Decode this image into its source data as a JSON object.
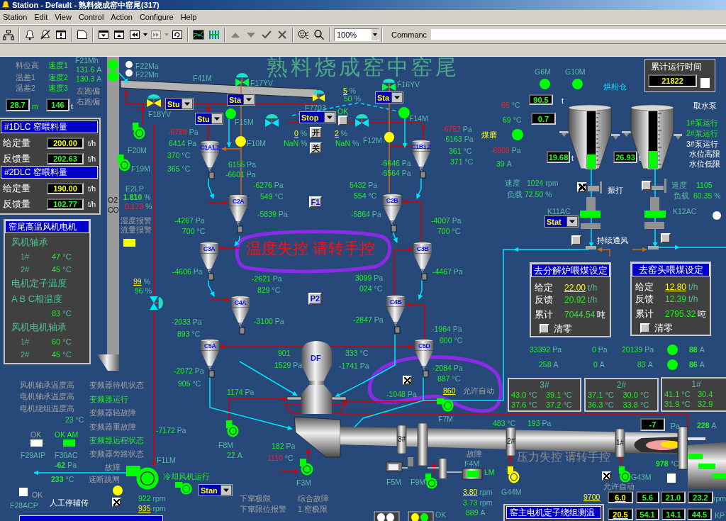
{
  "window": {
    "title": "Station - Default - 熟料烧成窑中窑尾(317)"
  },
  "menu": [
    "Station",
    "Edit",
    "View",
    "Control",
    "Action",
    "Configure",
    "Help"
  ],
  "toolbar": {
    "zoom": "100%",
    "command_label": "Commanc"
  },
  "diagram": {
    "title": "熟料烧成窑中窑尾",
    "banners": [
      {
        "text": "温度失控 请转手控",
        "kind": "alarm"
      },
      {
        "text": "压力失控 请转手控",
        "kind": "muted"
      }
    ],
    "labels": [
      {
        "text": "F21Mh",
        "kind": "tag"
      },
      {
        "text": "料位高",
        "kind": "muted"
      },
      {
        "text": "速度1",
        "kind": "value"
      },
      {
        "text": "131.6",
        "unit": "A",
        "kind": "value"
      },
      {
        "text": "F22Ma",
        "kind": "tag"
      },
      {
        "text": "G6M",
        "kind": "tag"
      },
      {
        "text": "G10M",
        "kind": "tag"
      },
      {
        "text": "温差1",
        "kind": "muted"
      },
      {
        "text": "速度2",
        "kind": "value"
      },
      {
        "text": "130.3",
        "unit": "A",
        "kind": "value"
      },
      {
        "text": "F22Mn",
        "kind": "tag"
      },
      {
        "text": "F41M",
        "kind": "tag"
      },
      {
        "text": "温差2",
        "kind": "muted"
      },
      {
        "text": "速度3",
        "kind": "value"
      },
      {
        "text": "左跑偏",
        "kind": "muted"
      },
      {
        "text": "F17YV",
        "kind": "tag"
      },
      {
        "text": "5",
        "unit": "%",
        "kind": "setpoint"
      },
      {
        "text": "F16YV",
        "kind": "tag"
      },
      {
        "text": "烘粉仓",
        "kind": "cyan"
      },
      {
        "text": "右跑偏",
        "kind": "muted"
      },
      {
        "text": "50",
        "unit": "%",
        "kind": "value"
      },
      {
        "text": "t",
        "kind": "note"
      },
      {
        "text": "m",
        "kind": "value"
      },
      {
        "text": "t",
        "kind": "note"
      },
      {
        "text": "F7703",
        "kind": "tag"
      },
      {
        "text": "66",
        "unit": "°C",
        "kind": "alarm"
      },
      {
        "text": "取水泵",
        "kind": "note"
      },
      {
        "text": "F18YV",
        "kind": "tag"
      },
      {
        "text": "OK",
        "kind": "value"
      },
      {
        "text": "F15M",
        "kind": "tag"
      },
      {
        "text": "F14M",
        "kind": "tag"
      },
      {
        "text": "69",
        "unit": "°C",
        "kind": "value"
      },
      {
        "text": "1#泵运行",
        "kind": "value"
      },
      {
        "text": "-6788",
        "unit": "Pa",
        "kind": "alarm"
      },
      {
        "text": "0",
        "unit": "%",
        "kind": "setpoint"
      },
      {
        "text": "2",
        "unit": "%",
        "kind": "setpoint"
      },
      {
        "text": "-6752",
        "unit": "Pa",
        "kind": "alarm"
      },
      {
        "text": "煤磨",
        "kind": "warning"
      },
      {
        "text": "2#泵运行",
        "kind": "value"
      },
      {
        "text": "6414",
        "unit": "Pa",
        "kind": "value"
      },
      {
        "text": "F10M",
        "kind": "tag"
      },
      {
        "text": "NaN",
        "unit": "%",
        "kind": "value"
      },
      {
        "text": "NaN",
        "unit": "%",
        "kind": "value"
      },
      {
        "text": "F12M",
        "kind": "tag"
      },
      {
        "text": "-6163",
        "unit": "Pa",
        "kind": "value"
      },
      {
        "text": "3#泵运行",
        "kind": "note"
      },
      {
        "text": "F20M",
        "kind": "tag"
      },
      {
        "text": "361",
        "unit": "°C",
        "kind": "value"
      },
      {
        "text": "-6903",
        "unit": "Pa",
        "kind": "alarm"
      },
      {
        "text": "370",
        "unit": "°C",
        "kind": "value"
      },
      {
        "text": "t",
        "kind": "note"
      },
      {
        "text": "t",
        "kind": "note"
      },
      {
        "text": "水位高限",
        "kind": "note"
      },
      {
        "text": "F19M",
        "kind": "tag"
      },
      {
        "text": "365",
        "unit": "°C",
        "kind": "value"
      },
      {
        "text": "6155",
        "unit": "Pa",
        "kind": "value"
      },
      {
        "text": "-6646",
        "unit": "Pa",
        "kind": "value"
      },
      {
        "text": "371",
        "unit": "°C",
        "kind": "value"
      },
      {
        "text": "39",
        "unit": "A",
        "kind": "value"
      },
      {
        "text": "水位低限",
        "kind": "note"
      },
      {
        "text": "-6601",
        "unit": "Pa",
        "kind": "value"
      },
      {
        "text": "-6564",
        "unit": "Pa",
        "kind": "value"
      },
      {
        "text": "E2LP",
        "kind": "tag"
      },
      {
        "text": "-6276",
        "unit": "Pa",
        "kind": "value"
      },
      {
        "text": "5432",
        "unit": "Pa",
        "kind": "value"
      },
      {
        "text": "速度",
        "kind": "tag"
      },
      {
        "text": "1024",
        "unit": "rpm",
        "kind": "value"
      },
      {
        "text": "振打",
        "kind": "note"
      },
      {
        "text": "速度",
        "kind": "tag"
      },
      {
        "text": "1105",
        "kind": "value"
      },
      {
        "text": "O2",
        "kind": "dark"
      },
      {
        "text": "1.810",
        "unit": "%",
        "kind": "strong"
      },
      {
        "text": "549",
        "unit": "°C",
        "kind": "value"
      },
      {
        "text": "554",
        "unit": "°C",
        "kind": "value"
      },
      {
        "text": "负载",
        "kind": "tag"
      },
      {
        "text": "72.50",
        "unit": "%",
        "kind": "value"
      },
      {
        "text": "负载",
        "kind": "tag"
      },
      {
        "text": "60.35",
        "unit": "%",
        "kind": "value"
      },
      {
        "text": "CO",
        "kind": "dark"
      },
      {
        "text": "0.173",
        "unit": "%",
        "kind": "alarm"
      },
      {
        "text": "-5839",
        "unit": "Pa",
        "kind": "value"
      },
      {
        "text": "-5864",
        "unit": "Pa",
        "kind": "value"
      },
      {
        "text": "K11AC",
        "kind": "tag"
      },
      {
        "text": "K12AC",
        "kind": "tag"
      },
      {
        "text": "湿度报警",
        "kind": "muted"
      },
      {
        "text": "-4267",
        "unit": "Pa",
        "kind": "value"
      },
      {
        "text": "-4007",
        "unit": "Pa",
        "kind": "value"
      },
      {
        "text": "流量报警",
        "kind": "muted"
      },
      {
        "text": "700",
        "unit": "°C",
        "kind": "value"
      },
      {
        "text": "700",
        "unit": "°C",
        "kind": "value"
      },
      {
        "text": "持续通风",
        "kind": "note"
      },
      {
        "text": "-4606",
        "unit": "Pa",
        "kind": "value"
      },
      {
        "text": "-4467",
        "unit": "Pa",
        "kind": "value"
      },
      {
        "text": "99",
        "unit": "%",
        "kind": "setpoint"
      },
      {
        "text": "-2621",
        "unit": "Pa",
        "kind": "value"
      },
      {
        "text": "3099",
        "unit": "Pa",
        "kind": "value"
      },
      {
        "text": "96",
        "unit": "%",
        "kind": "value"
      },
      {
        "text": "829",
        "unit": "°C",
        "kind": "value"
      },
      {
        "text": "024",
        "unit": "°C",
        "kind": "value"
      },
      {
        "text": "-2033",
        "unit": "Pa",
        "kind": "value"
      },
      {
        "text": "-3100",
        "unit": "Pa",
        "kind": "value"
      },
      {
        "text": "-2847",
        "unit": "Pa",
        "kind": "value"
      },
      {
        "text": "-1964",
        "unit": "Pa",
        "kind": "value"
      },
      {
        "text": "893",
        "unit": "°C",
        "kind": "value"
      },
      {
        "text": "000",
        "unit": "°C",
        "kind": "value"
      },
      {
        "text": "901",
        "kind": "value"
      },
      {
        "text": "333",
        "unit": "°C",
        "kind": "value"
      },
      {
        "text": "33392",
        "unit": "Pa",
        "kind": "value"
      },
      {
        "text": "0",
        "unit": "Pa",
        "kind": "value"
      },
      {
        "text": "20139",
        "unit": "Pa",
        "kind": "value"
      },
      {
        "text": "88",
        "unit": "A",
        "kind": "strong"
      },
      {
        "text": "1529",
        "unit": "Pa",
        "kind": "value"
      },
      {
        "text": "-1741",
        "unit": "Pa",
        "kind": "value"
      },
      {
        "text": "258",
        "unit": "A",
        "kind": "value"
      },
      {
        "text": "0",
        "unit": "A",
        "kind": "value"
      },
      {
        "text": "83",
        "unit": "A",
        "kind": "value"
      },
      {
        "text": "86",
        "unit": "A",
        "kind": "strong"
      },
      {
        "text": "-2072",
        "unit": "Pa",
        "kind": "value"
      },
      {
        "text": "-2084",
        "unit": "Pa",
        "kind": "value"
      },
      {
        "text": "887",
        "unit": "°C",
        "kind": "value"
      },
      {
        "text": "风机轴承温度高",
        "kind": "muted"
      },
      {
        "text": "变频器待机状态",
        "kind": "muted"
      },
      {
        "text": "905",
        "unit": "°C",
        "kind": "value"
      },
      {
        "text": "1174",
        "unit": "Pa",
        "kind": "value"
      },
      {
        "text": "860",
        "kind": "setpoint"
      },
      {
        "text": "允许自动",
        "kind": "muted"
      },
      {
        "text": "电机轴承温度高",
        "kind": "muted"
      },
      {
        "text": "-1048",
        "unit": "Pa",
        "kind": "value"
      },
      {
        "text": "变频器运行",
        "kind": "value"
      },
      {
        "text": "电机绕组温度高",
        "kind": "muted"
      },
      {
        "text": "变频器轻故障",
        "kind": "muted"
      },
      {
        "text": "23",
        "unit": "°C",
        "kind": "value"
      },
      {
        "text": "F7M",
        "kind": "tag"
      },
      {
        "text": "变频器重故障",
        "kind": "muted"
      },
      {
        "text": "483",
        "unit": "°C",
        "kind": "value"
      },
      {
        "text": "193",
        "unit": "Pa",
        "kind": "value"
      },
      {
        "text": "Pa",
        "kind": "tag"
      },
      {
        "text": "228",
        "unit": "A",
        "kind": "strong"
      },
      {
        "text": "OK",
        "kind": "muted"
      },
      {
        "text": "OK AM",
        "kind": "value"
      },
      {
        "text": "-7172",
        "unit": "Pa",
        "kind": "value"
      },
      {
        "text": "变频器远程状态",
        "kind": "value"
      },
      {
        "text": "F8M",
        "kind": "tag"
      },
      {
        "text": "182",
        "unit": "Pa",
        "kind": "value"
      },
      {
        "text": "F29AIP",
        "kind": "tag"
      },
      {
        "text": "F30AC",
        "kind": "tag"
      },
      {
        "text": "变频器旁路状态",
        "kind": "muted"
      },
      {
        "text": "F1LM",
        "kind": "tag"
      },
      {
        "text": "22",
        "unit": "A",
        "kind": "value"
      },
      {
        "text": "1110",
        "unit": "°C",
        "kind": "alarm"
      },
      {
        "text": "故障",
        "kind": "muted"
      },
      {
        "text": "-62",
        "unit": "Pa",
        "kind": "strong"
      },
      {
        "text": "故障",
        "kind": "muted"
      },
      {
        "text": "F4M",
        "kind": "tag"
      },
      {
        "text": "978",
        "unit": "°C",
        "kind": "strong"
      },
      {
        "text": "LM",
        "kind": "value"
      },
      {
        "text": "233",
        "unit": "°C",
        "kind": "strong"
      },
      {
        "text": "速断跳闸",
        "kind": "muted"
      },
      {
        "text": "冷却风机运行",
        "kind": "value"
      },
      {
        "text": "G43M",
        "kind": "tag"
      },
      {
        "text": "F3M",
        "kind": "tag"
      },
      {
        "text": "F5M",
        "kind": "tag"
      },
      {
        "text": "F9M",
        "kind": "tag"
      },
      {
        "text": "允许自动",
        "kind": "muted"
      },
      {
        "text": "OK",
        "kind": "muted"
      },
      {
        "text": "922",
        "unit": "rpm",
        "kind": "value"
      },
      {
        "text": "下窜极限",
        "kind": "muted"
      },
      {
        "text": "综合故障",
        "kind": "muted"
      },
      {
        "text": "3.80",
        "unit": "rpm",
        "kind": "setpoint"
      },
      {
        "text": "G44M",
        "kind": "tag"
      },
      {
        "text": "9700",
        "kind": "setpoint"
      },
      {
        "text": "rpm",
        "kind": "tag"
      },
      {
        "text": "F28ACP",
        "kind": "tag"
      },
      {
        "text": "人工停辅传",
        "kind": "note"
      },
      {
        "text": "3.73",
        "unit": "rpm",
        "kind": "value"
      },
      {
        "text": "935",
        "unit": "rpm",
        "kind": "setpoint"
      },
      {
        "text": "下窜限位报警",
        "kind": "muted"
      },
      {
        "text": "1.窑极限",
        "kind": "muted"
      },
      {
        "text": "OK",
        "kind": "tag"
      },
      {
        "text": "889",
        "unit": "A",
        "kind": "value"
      },
      {
        "text": "KP",
        "kind": "tag"
      }
    ],
    "readouts": [
      {
        "value": "28.7",
        "kind": "actual"
      },
      {
        "value": "146",
        "kind": "actual"
      },
      {
        "value": "90.5",
        "kind": "actual"
      },
      {
        "value": "0.7",
        "kind": "actual"
      },
      {
        "value": "19.68",
        "kind": "actual"
      },
      {
        "value": "26.93",
        "kind": "actual"
      },
      {
        "value": "-7",
        "kind": "actual"
      },
      {
        "value": "6.0",
        "kind": "set_link"
      },
      {
        "value": "5.6",
        "kind": "actual"
      },
      {
        "value": "21.0",
        "kind": "actual"
      },
      {
        "value": "23.2",
        "kind": "actual"
      },
      {
        "value": "20.5",
        "kind": "set_link"
      },
      {
        "value": "54.1",
        "kind": "actual"
      },
      {
        "value": "14.1",
        "kind": "actual"
      },
      {
        "value": "44.5",
        "kind": "actual"
      }
    ],
    "dropdowns": [
      {
        "value": "Stu"
      },
      {
        "value": "Sta"
      },
      {
        "value": "Sta"
      },
      {
        "value": "Stu"
      },
      {
        "value": "Stop"
      },
      {
        "value": "Stat"
      },
      {
        "value": "Stan"
      }
    ],
    "buttons": [
      {
        "label": "开",
        "kind": "command"
      },
      {
        "label": "关",
        "kind": "command"
      },
      {
        "label": "F1",
        "kind": "page"
      },
      {
        "label": "P2",
        "kind": "page"
      }
    ],
    "checkboxes": [
      {
        "checked": true
      },
      {
        "checked": false
      },
      {
        "checked": false
      },
      {
        "checked": false
      },
      {
        "checked": true
      },
      {
        "checked": true
      },
      {
        "checked": true
      }
    ],
    "lamps": [
      {
        "color": "#00ff00",
        "kind": "dot"
      },
      {
        "color": "#ffffff",
        "kind": "dot"
      },
      {
        "color": "#00ff00",
        "kind": "dot"
      },
      {
        "color": "#ffffff",
        "kind": "dot"
      },
      {
        "color": "#00ff00",
        "kind": "dot"
      },
      {
        "color": "#00ff00",
        "kind": "dot"
      },
      {
        "color": "#ffffff",
        "kind": "block"
      },
      {
        "color": "#00ff00",
        "kind": "dot"
      },
      {
        "color": "#00ff00",
        "kind": "dot"
      },
      {
        "color": "#ffff00",
        "kind": "dot"
      },
      {
        "color": "#ffff00",
        "kind": "dot"
      },
      {
        "color": "#00ff00",
        "kind": "dot"
      },
      {
        "color": "#ffffff",
        "kind": "dot"
      },
      {
        "color": "#ffff00",
        "kind": "block"
      },
      {
        "color": "#00ff00",
        "kind": "dot"
      },
      {
        "color": "#00ff00",
        "kind": "dot"
      },
      {
        "color": "#ffffff",
        "kind": "block"
      },
      {
        "color": "#00ff00",
        "kind": "block"
      },
      {
        "color": "#ffffff",
        "kind": "block"
      },
      {
        "color": "#ffffff",
        "kind": "block"
      },
      {
        "color": "#ffff00",
        "kind": "dot"
      },
      {
        "color": "#ffffff",
        "kind": "dot"
      },
      {
        "color": "#ffffff",
        "kind": "dot"
      },
      {
        "color": "#ffff00",
        "kind": "dot"
      },
      {
        "color": "#00ff00",
        "kind": "dot"
      }
    ],
    "fans": [
      {
        "color": "#00ff00"
      },
      {
        "color": "#00ff00"
      },
      {
        "color": "#00ff00"
      },
      {
        "color": "#00ff00"
      },
      {
        "color": "#00ff00"
      },
      {
        "color": "#00ff00"
      },
      {
        "color": "#00ff00"
      },
      {
        "color": "#00ff00"
      },
      {
        "color": "#ffff00"
      },
      {
        "color": "#00ff00"
      }
    ],
    "valves": [
      {
        "color": "#ffff00"
      },
      {
        "color": "#00ff40"
      },
      {
        "color": "#ffff00"
      },
      {
        "color": "#00ff40"
      },
      {
        "color": "#00e8ff"
      },
      {
        "color": "#00e8ff"
      },
      {
        "color": "#00e8ff"
      }
    ],
    "cyclones": [
      {
        "name": "C1A1,2"
      },
      {
        "name": "C1B1,2"
      },
      {
        "name": "C2A"
      },
      {
        "name": "C2B"
      },
      {
        "name": "C3A"
      },
      {
        "name": "C3B"
      },
      {
        "name": "C4A"
      },
      {
        "name": "C4B"
      },
      {
        "name": "C5A"
      },
      {
        "name": "C5D"
      }
    ],
    "calciner": {
      "name": "DF"
    },
    "kiln_rings": [
      "3#",
      "2#",
      "1#"
    ],
    "silos": [
      {
        "level": 0.24
      },
      {
        "level": 0.3
      }
    ],
    "feed_panel": {
      "sections": [
        {
          "title": "#1DLC 窑喂料量",
          "rows": [
            {
              "label": "给定量",
              "value": "200.00",
              "unit": "t/h",
              "kind": "set"
            },
            {
              "label": "反馈量",
              "value": "202.63",
              "unit": "t/h",
              "kind": "actual"
            }
          ]
        },
        {
          "title": "#2DLC 窑喂料量",
          "rows": [
            {
              "label": "给定量",
              "value": "190.00",
              "unit": "t/h",
              "kind": "set"
            },
            {
              "label": "反馈量",
              "value": "102.77",
              "unit": "t/h",
              "kind": "actual"
            }
          ]
        }
      ]
    },
    "motor_panel": {
      "title": "窑尾高温风机电机",
      "items": [
        {
          "kind": "heading",
          "text": "风机轴承"
        },
        {
          "kind": "reading",
          "label": "1#",
          "value": "47",
          "unit": "°C"
        },
        {
          "kind": "reading",
          "label": "2#",
          "value": "45",
          "unit": "°C"
        },
        {
          "kind": "heading",
          "text": "电机定子温度"
        },
        {
          "kind": "heading",
          "text": "A B C相温度"
        },
        {
          "kind": "reading",
          "value": "83",
          "unit": "°C"
        },
        {
          "kind": "heading",
          "text": "风机电机轴承"
        },
        {
          "kind": "reading",
          "label": "1#",
          "value": "60",
          "unit": "°C"
        },
        {
          "kind": "reading",
          "label": "2#",
          "value": "45",
          "unit": "°C"
        }
      ]
    },
    "runtime_panel": {
      "title": "累计运行时间",
      "value": "21822"
    },
    "coal_panels": [
      {
        "title": "去分解炉喂煤设定",
        "rows": [
          {
            "label": "给定",
            "value": "22.00",
            "unit": "t/h",
            "kind": "set"
          },
          {
            "label": "反馈",
            "value": "20.92",
            "unit": "t/h",
            "kind": "actual"
          },
          {
            "label": "累计",
            "value": "7044.54",
            "unit": "吨",
            "kind": "total"
          }
        ],
        "reset": {
          "label": "清零",
          "checked": false
        }
      },
      {
        "title": "去窑头喂煤设定",
        "rows": [
          {
            "label": "给定",
            "value": "12.80",
            "unit": "t/h",
            "kind": "set"
          },
          {
            "label": "反馈",
            "value": "12.39",
            "unit": "t/h",
            "kind": "actual"
          },
          {
            "label": "累计",
            "value": "2795.32",
            "unit": "吨",
            "kind": "total"
          }
        ],
        "reset": {
          "label": "清零",
          "checked": false
        }
      }
    ],
    "temperature_panels": [
      {
        "title": "3#",
        "readings": [
          {
            "value": "43.0",
            "unit": "°C"
          },
          {
            "value": "39.1",
            "unit": "°C"
          },
          {
            "value": "37.6",
            "unit": "°C"
          },
          {
            "value": "37.2",
            "unit": "°C"
          }
        ]
      },
      {
        "title": "2#",
        "readings": [
          {
            "value": "37.1",
            "unit": "°C"
          },
          {
            "value": "30.0",
            "unit": "°C"
          },
          {
            "value": "36.3",
            "unit": "°C"
          },
          {
            "value": "33.8",
            "unit": "°C"
          }
        ]
      },
      {
        "title": "1#",
        "readings": [
          {
            "value": "41.1",
            "unit": "°C"
          },
          {
            "value": "30.4"
          },
          {
            "value": "31.9",
            "unit": "°C"
          },
          {
            "value": "32.9"
          }
        ]
      }
    ],
    "stator_panel": {
      "title": "窑主电机定子绕组测温"
    }
  }
}
